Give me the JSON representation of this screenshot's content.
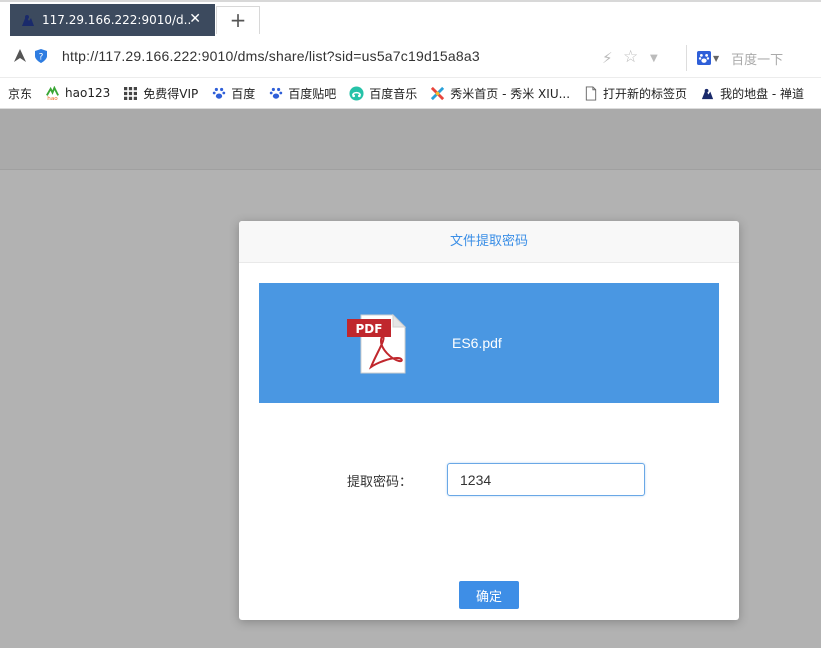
{
  "browser": {
    "tab_title": "117.29.166.222:9010/d...",
    "tab_close": "✕",
    "new_tab": "+",
    "url": "http://117.29.166.222:9010/dms/share/list?sid=us5a7c19d15a8a3",
    "search_placeholder": "百度一下"
  },
  "bookmarks": [
    {
      "label": "京东",
      "icon": "jd-icon"
    },
    {
      "label": "hao123",
      "icon": "hao123-icon"
    },
    {
      "label": "免费得VIP",
      "icon": "grid-icon"
    },
    {
      "label": "百度",
      "icon": "baidu-paw-icon"
    },
    {
      "label": "百度贴吧",
      "icon": "baidu-paw-icon"
    },
    {
      "label": "百度音乐",
      "icon": "music-icon"
    },
    {
      "label": "秀米首页 - 秀米 XIU...",
      "icon": "xiumi-icon"
    },
    {
      "label": "打开新的标签页",
      "icon": "page-icon"
    },
    {
      "label": "我的地盘 - 禅道",
      "icon": "zentao-icon"
    }
  ],
  "modal": {
    "title": "文件提取密码",
    "file_name": "ES6.pdf",
    "file_badge": "PDF",
    "password_label": "提取密码：",
    "password_value": "1234",
    "confirm_label": "确定"
  },
  "colors": {
    "accent": "#3e8ee6",
    "file_card": "#4a97e2",
    "overlay": "#b2b2b2",
    "tab_bg": "#3c4a5e"
  }
}
